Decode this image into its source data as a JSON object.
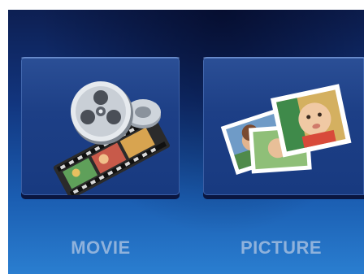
{
  "menu": {
    "items": [
      {
        "label": "MOVIE",
        "icon": "film-reel-icon"
      },
      {
        "label": "PICTURE",
        "icon": "photos-icon"
      }
    ]
  },
  "colors": {
    "background_top": "#0d1f52",
    "background_bottom": "#2a7ed0",
    "tile": "#1d3f86",
    "label": "#8fb2dc"
  }
}
